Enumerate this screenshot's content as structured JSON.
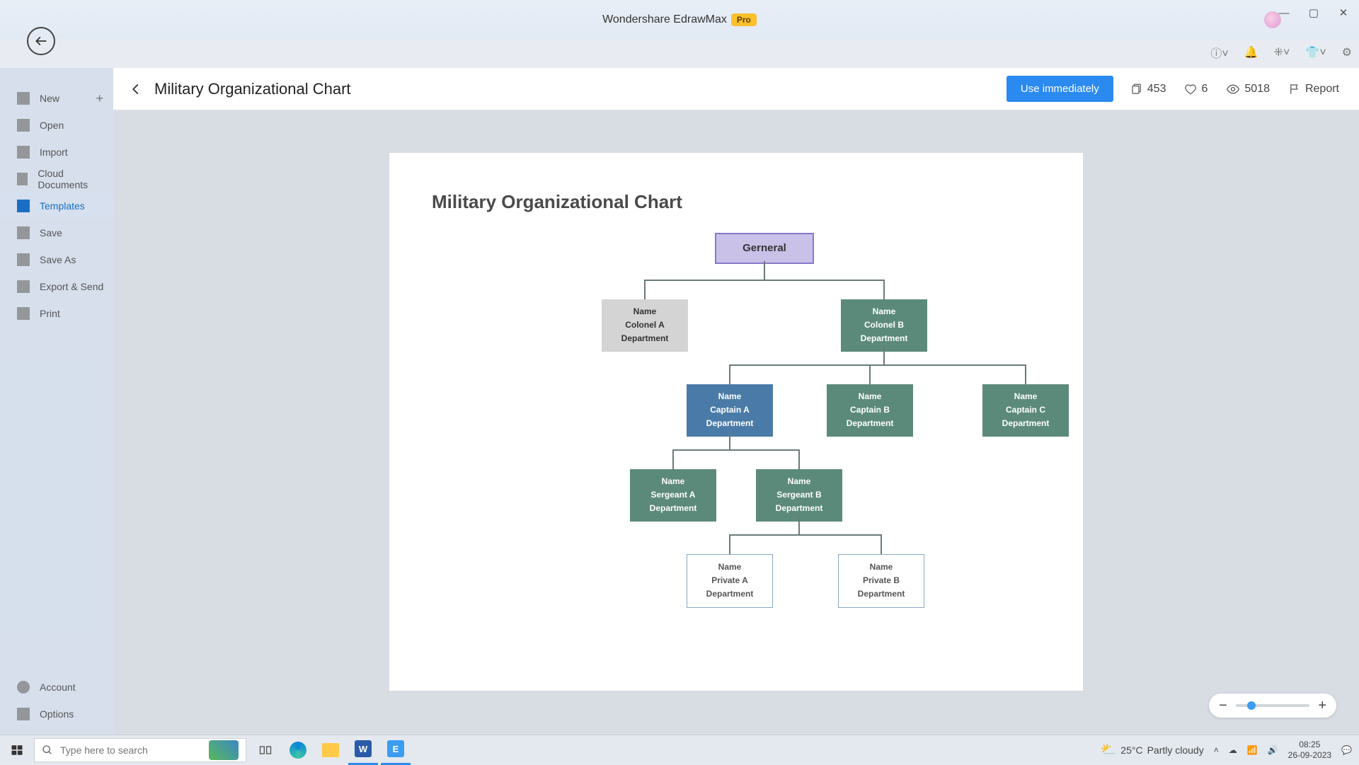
{
  "app": {
    "title": "Wondershare EdrawMax",
    "badge": "Pro"
  },
  "sidebar": {
    "items": [
      {
        "label": "New",
        "has_plus": true
      },
      {
        "label": "Open"
      },
      {
        "label": "Import"
      },
      {
        "label": "Cloud Documents"
      },
      {
        "label": "Templates",
        "active": true
      },
      {
        "label": "Save"
      },
      {
        "label": "Save As"
      },
      {
        "label": "Export & Send"
      },
      {
        "label": "Print"
      }
    ],
    "bottom": [
      {
        "label": "Account"
      },
      {
        "label": "Options"
      }
    ]
  },
  "header": {
    "title": "Military Organizational Chart",
    "use_btn": "Use immediately",
    "copies": "453",
    "likes": "6",
    "views": "5018",
    "report": "Report"
  },
  "doc": {
    "title": "Military Organizational Chart"
  },
  "org": {
    "general": "Gerneral",
    "colonel_a": {
      "l1": "Name",
      "l2": "Colonel A",
      "l3": "Department"
    },
    "colonel_b": {
      "l1": "Name",
      "l2": "Colonel B",
      "l3": "Department"
    },
    "captain_a": {
      "l1": "Name",
      "l2": "Captain A",
      "l3": "Department"
    },
    "captain_b": {
      "l1": "Name",
      "l2": "Captain B",
      "l3": "Department"
    },
    "captain_c": {
      "l1": "Name",
      "l2": "Captain C",
      "l3": "Department"
    },
    "sergeant_a": {
      "l1": "Name",
      "l2": "Sergeant A",
      "l3": "Department"
    },
    "sergeant_b": {
      "l1": "Name",
      "l2": "Sergeant B",
      "l3": "Department"
    },
    "private_a": {
      "l1": "Name",
      "l2": "Private A",
      "l3": "Department"
    },
    "private_b": {
      "l1": "Name",
      "l2": "Private B",
      "l3": "Department"
    }
  },
  "taskbar": {
    "search_placeholder": "Type here to search",
    "weather_temp": "25°C",
    "weather_text": "Partly cloudy",
    "time": "08:25",
    "date": "26-09-2023"
  }
}
